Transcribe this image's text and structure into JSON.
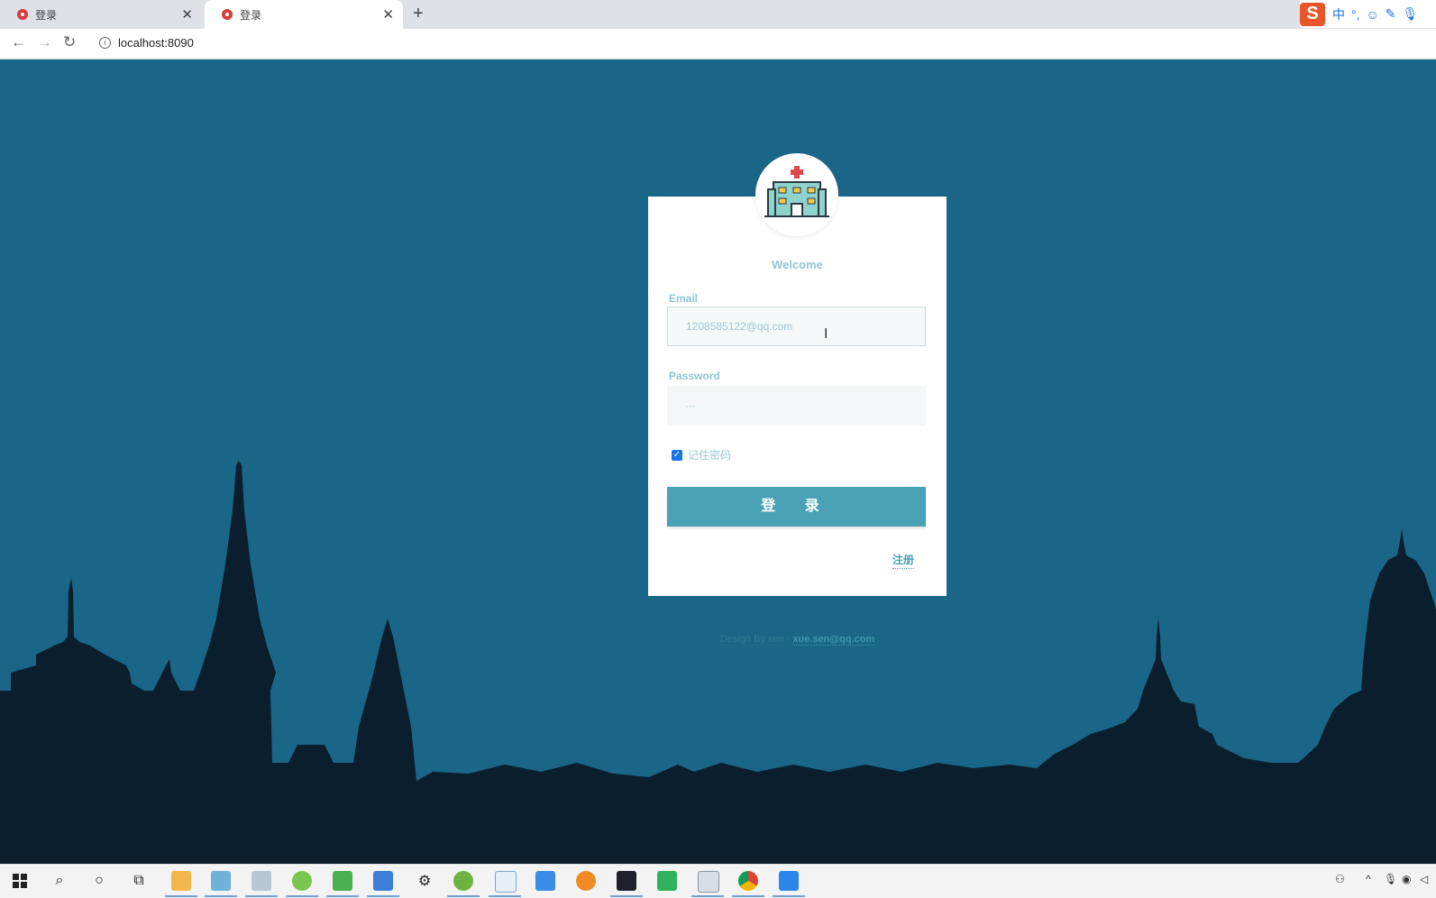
{
  "browser": {
    "tabs": [
      {
        "title": "登录",
        "active": false
      },
      {
        "title": "登录",
        "active": true
      }
    ],
    "url": "localhost:8090",
    "ime": {
      "logo": "S",
      "mode": "中"
    }
  },
  "login": {
    "welcome": "Welcome",
    "email_label": "Email",
    "email_value": "1208585122@qq.com",
    "password_label": "Password",
    "password_value": "···",
    "remember_label": "记住密码",
    "remember_checked": true,
    "login_button": "登 录",
    "register_link": "注册"
  },
  "footer": {
    "prefix": "Design By sen · ",
    "email": "xue.sen@qq.com"
  },
  "taskbar": {
    "apps": [
      "windows-start",
      "search",
      "cortana",
      "task-view",
      "file-explorer",
      "notes",
      "screenshot",
      "green-app",
      "editor",
      "store",
      "settings",
      "spring",
      "hub",
      "wps",
      "search-orange",
      "intellij",
      "hbuilder",
      "terminal",
      "chrome",
      "meeting"
    ]
  },
  "colors": {
    "background": "#1a6688",
    "accent": "#49a1b5",
    "skyline": "#0a1e2d"
  }
}
